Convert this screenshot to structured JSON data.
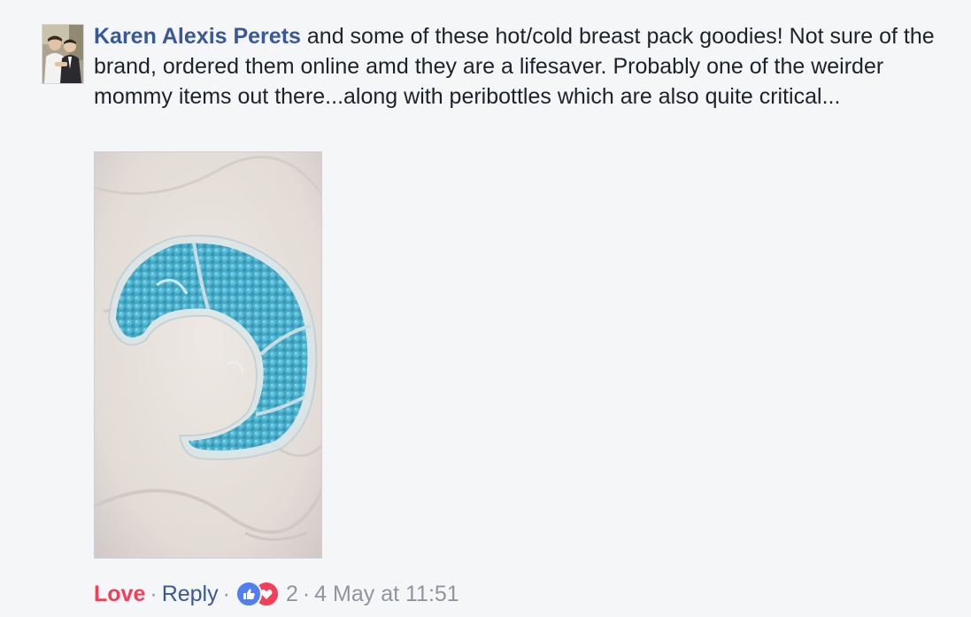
{
  "comment": {
    "author": "Karen Alexis Perets",
    "text": " and some of these hot/cold breast pack goodies! Not sure of the brand, ordered them online amd they are a lifesaver. Probably one of the weirder mommy items out there...along with peribottles which are also quite critical...",
    "attachment_icon": "photo-of-blue-gel-breast-pack"
  },
  "actions": {
    "love_label": "Love",
    "separator": "·",
    "reply_label": "Reply",
    "reaction_count": "2",
    "timestamp": "4 May at 11:51"
  },
  "colors": {
    "author": "#385898",
    "love": "#f33e58",
    "meta": "#90949c",
    "like_reaction": "#4f7ff0",
    "heart_reaction": "#f33e58"
  }
}
